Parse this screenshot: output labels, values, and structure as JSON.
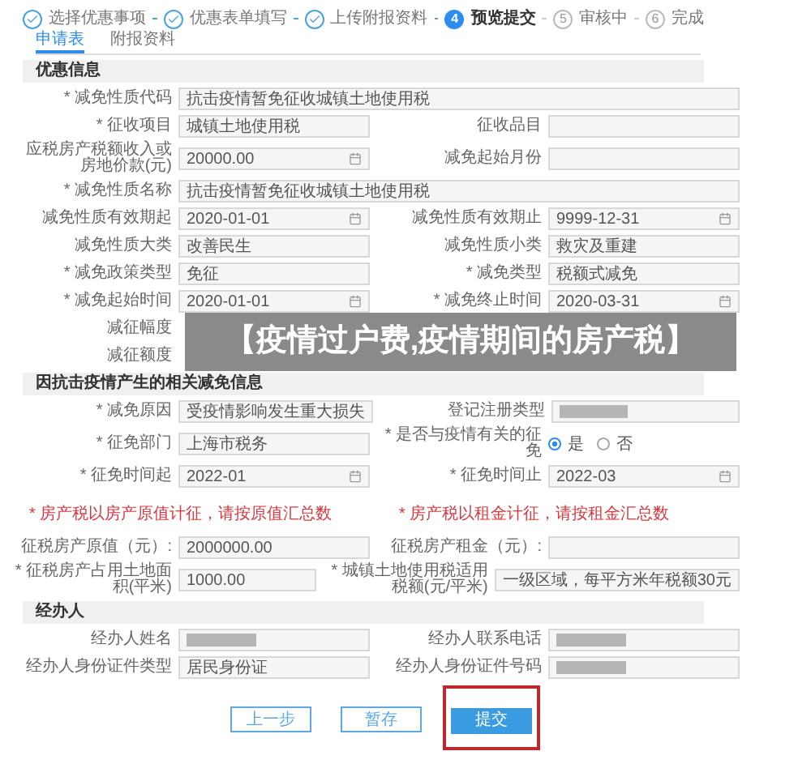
{
  "steps": [
    {
      "label": "选择优惠事项",
      "completed": true,
      "selected": false
    },
    {
      "label": "优惠表单填写",
      "completed": true,
      "selected": false
    },
    {
      "label": "上传附报资料",
      "completed": true,
      "selected": false
    },
    {
      "number": "4",
      "label": "预览提交",
      "completed": false,
      "selected": true
    },
    {
      "number": "5",
      "label": "审核中",
      "completed": false,
      "selected": false
    },
    {
      "number": "6",
      "label": "完成",
      "completed": false,
      "selected": false
    }
  ],
  "tabs": [
    {
      "label": "申请表",
      "selected": true
    },
    {
      "label": "附报资料",
      "selected": false
    }
  ],
  "sections": [
    {
      "title": "优惠信息",
      "rows": [
        [
          {
            "label": "* 减免性质代码",
            "kind": "text",
            "wide": true,
            "value": "抗击疫情暂免征收城镇土地使用税"
          }
        ],
        [
          {
            "label": "* 征收项目",
            "kind": "text",
            "value": "城镇土地使用税"
          },
          {
            "label": "征收品目",
            "kind": "text"
          }
        ],
        [
          {
            "label": "应税房产税额收入或房地价款(元)",
            "kind": "date",
            "value": "20000.00"
          },
          {
            "label": "减免起始月份",
            "kind": "text"
          }
        ],
        [
          {
            "label": "* 减免性质名称",
            "kind": "text",
            "wide": true,
            "value": "抗击疫情暂免征收城镇土地使用税"
          }
        ],
        [
          {
            "label": "减免性质有效期起",
            "kind": "date",
            "value": "2020-01-01"
          },
          {
            "label": "减免性质有效期止",
            "kind": "date",
            "value": "9999-12-31"
          }
        ],
        [
          {
            "label": "减免性质大类",
            "kind": "text",
            "value": "改善民生"
          },
          {
            "label": "减免性质小类",
            "kind": "text",
            "value": "救灾及重建"
          }
        ],
        [
          {
            "label": "* 减免政策类型",
            "kind": "text",
            "value": "免征"
          },
          {
            "label": "* 减免类型",
            "kind": "text",
            "value": "税额式减免"
          }
        ],
        [
          {
            "label": "* 减免起始时间",
            "kind": "date",
            "value": "2020-01-01"
          },
          {
            "label": "* 减免终止时间",
            "kind": "date",
            "value": "2020-03-31"
          }
        ],
        [
          {
            "label": "减征幅度",
            "kind": "label"
          }
        ],
        [
          {
            "label": "减征额度",
            "kind": "label"
          }
        ]
      ]
    },
    {
      "title": "因抗击疫情产生的相关减免信息",
      "rows": [
        [
          {
            "label": "* 减免原因",
            "kind": "text",
            "value": "受疫情影响发生重大损失"
          },
          {
            "label": "登记注册类型",
            "kind": "redacted"
          }
        ],
        [
          {
            "label": "* 征免部门",
            "kind": "text",
            "value": "上海市税务"
          },
          {
            "label": "* 是否与疫情有关的征免",
            "kind": "radio",
            "options": [
              {
                "label": "是",
                "selected": true
              },
              {
                "label": "否",
                "selected": false
              }
            ]
          }
        ],
        [
          {
            "label": "* 征免时间起",
            "kind": "date",
            "value": "2022-01"
          },
          {
            "label": "* 征免时间止",
            "kind": "date",
            "value": "2022-03"
          }
        ],
        [
          {
            "kind": "note",
            "text": "* 房产税以房产原值计征，请按原值汇总数"
          },
          {
            "kind": "note",
            "text": "* 房产税以租金计征，请按租金汇总数"
          }
        ],
        [
          {
            "label": "征税房产原值（元）:",
            "kind": "text",
            "value": "2000000.00"
          },
          {
            "label": "征税房产租金（元）:",
            "kind": "text"
          }
        ],
        [
          {
            "label": "* 征税房产占用土地面积(平米)",
            "kind": "text",
            "value": "1000.00"
          },
          {
            "label": "* 城镇土地使用税适用税额(元/平米)",
            "kind": "text",
            "value": "一级区域，每平方米年税额30元"
          }
        ]
      ]
    },
    {
      "title": "经办人",
      "rows": [
        [
          {
            "label": "经办人姓名",
            "kind": "redacted"
          },
          {
            "label": "经办人联系电话",
            "kind": "redacted"
          }
        ],
        [
          {
            "label": "经办人身份证件类型",
            "kind": "text",
            "value": "居民身份证"
          },
          {
            "label": "经办人身份证件号码",
            "kind": "redacted"
          }
        ]
      ]
    }
  ],
  "buttons": [
    {
      "label": "上一步",
      "kind": "secondary",
      "highlighted": false
    },
    {
      "label": "暂存",
      "kind": "secondary",
      "highlighted": false
    },
    {
      "label": "提交",
      "kind": "primary",
      "highlighted": true
    }
  ],
  "banner": {
    "title": "【疫情过户费,疫情期间的房产税】"
  }
}
